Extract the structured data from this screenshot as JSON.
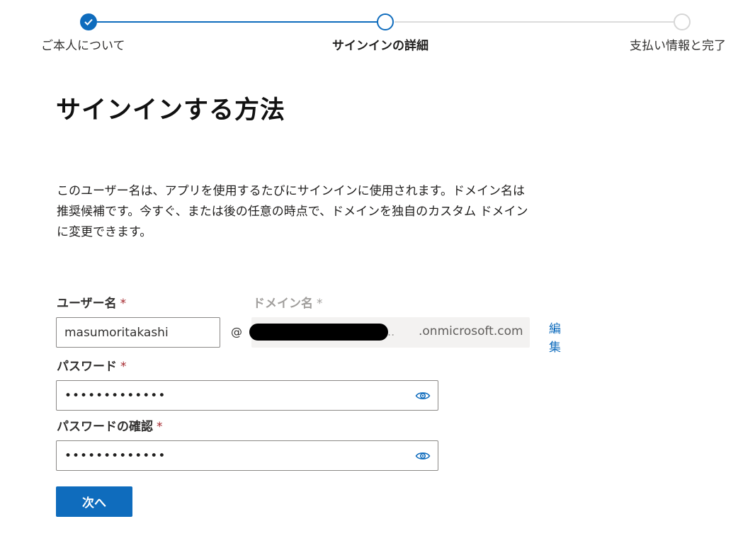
{
  "stepper": {
    "steps": [
      {
        "label": "ご本人について",
        "state": "complete"
      },
      {
        "label": "サインインの詳細",
        "state": "current"
      },
      {
        "label": "支払い情報と完了",
        "state": "upcoming"
      }
    ]
  },
  "page": {
    "title": "サインインする方法",
    "description_lines": [
      "このユーザー名は、アプリを使用するたびにサインインに使用されます。ドメイン名は",
      "推奨候補です。今すぐ、または後の任意の時点で、ドメインを独自のカスタム ドメイン",
      "に変更できます。"
    ]
  },
  "form": {
    "username": {
      "label": "ユーザー名",
      "required_mark": "*",
      "value": "masumoritakashi"
    },
    "at_sign": "@",
    "domain": {
      "label": "ドメイン名",
      "required_mark": "*",
      "trailing": "..",
      "suffix": ".onmicrosoft.com",
      "edit_label": "編集"
    },
    "password": {
      "label": "パスワード",
      "required_mark": "*",
      "masked_value": "•••••••••••••",
      "toggle_icon": "eye-icon"
    },
    "confirm_password": {
      "label": "パスワードの確認",
      "required_mark": "*",
      "masked_value": "•••••••••••••",
      "toggle_icon": "eye-icon"
    },
    "next_button": "次へ"
  },
  "colors": {
    "accent": "#0f6cbd",
    "required": "#a4262c",
    "disabled_text": "#a19f9d",
    "domain_background": "#f3f2f1"
  }
}
